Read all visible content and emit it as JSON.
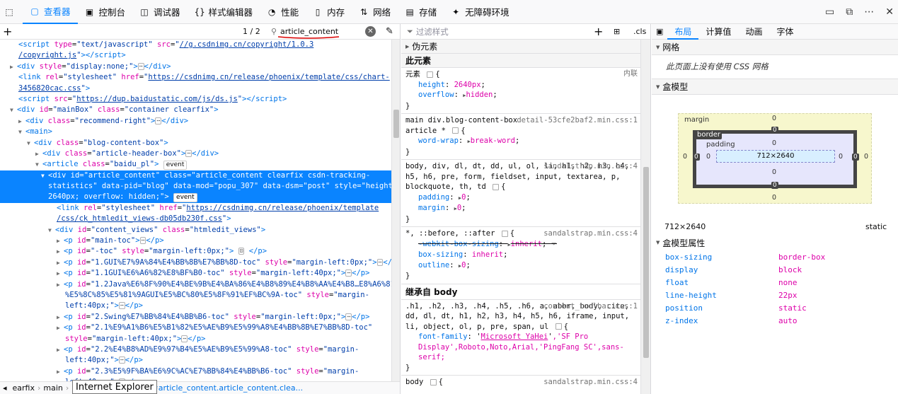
{
  "toolbar": {
    "tabs": [
      {
        "icon": "inspector-icon",
        "glyph": "▢",
        "label": "查看器"
      },
      {
        "icon": "console-icon",
        "glyph": "▣",
        "label": "控制台"
      },
      {
        "icon": "debugger-icon",
        "glyph": "◫",
        "label": "调试器"
      },
      {
        "icon": "style-editor-icon",
        "glyph": "{}",
        "label": "样式编辑器"
      },
      {
        "icon": "performance-icon",
        "glyph": "◔",
        "label": "性能"
      },
      {
        "icon": "memory-icon",
        "glyph": "▯",
        "label": "内存"
      },
      {
        "icon": "network-icon",
        "glyph": "⇅",
        "label": "网络"
      },
      {
        "icon": "storage-icon",
        "glyph": "▤",
        "label": "存储"
      },
      {
        "icon": "accessibility-icon",
        "glyph": "✦",
        "label": "无障碍环境"
      }
    ],
    "active_tab": "查看器"
  },
  "markup": {
    "search_count": "1 / 2",
    "search_value": "article_content",
    "breadcrumbs": [
      "earfix",
      "main",
      "article.baidu_pl",
      "div#article_content.article_content.clea..."
    ],
    "tooltip": "Internet Explorer"
  },
  "rules": {
    "filter_placeholder": "过滤样式",
    "cls_label": ".cls",
    "pseudo_label": "伪元素",
    "this_element_label": "此元素",
    "inherited_label": "继承自 body",
    "element_rule": {
      "selector": "元素",
      "source": "内联",
      "decls": [
        [
          "height",
          "2640px"
        ],
        [
          "overflow",
          "hidden"
        ]
      ]
    },
    "rule2": {
      "selector": "main div.blog-content-box article *",
      "source": "detail-53cfe2baf2.min.css:1",
      "decls": [
        [
          "word-wrap",
          "break-word"
        ]
      ]
    },
    "rule3": {
      "selector": "body, div, dl, dt, dd, ul, ol, li, h1, h2, h3, h4, h5, h6, pre, form, fieldset, input, textarea, p, blockquote, th, td",
      "source": "sandalstrap.min.css:4",
      "decls": [
        [
          "padding",
          "0"
        ],
        [
          "margin",
          "0"
        ]
      ]
    },
    "rule4": {
      "selector": "*, ::before, ::after",
      "source": "sandalstrap.min.css:4",
      "decls": [
        [
          "-webkit-box-sizing",
          "inherit"
        ],
        [
          "box-sizing",
          "inherit"
        ],
        [
          "outline",
          "0"
        ]
      ]
    },
    "rule5": {
      "selector": ".h1, .h2, .h3, .h4, .h5, .h6, a, abbr, body, cite, dd, dl, dt, h1, h2, h3, h4, h5, h6, iframe, input, li, object, ol, p, pre, span, ul",
      "source": "content_toolbar.css:1",
      "decl_name": "font-family",
      "decl_link": "Microsoft YaHei",
      "decl_rest": ",'SF Pro Display',Roboto,Noto,Arial,'PingFang SC',sans-serif;"
    },
    "rule6": {
      "selector": "body",
      "source": "sandalstrap.min.css:4"
    }
  },
  "layout": {
    "tabs": [
      "布局",
      "计算值",
      "动画",
      "字体"
    ],
    "active_tab": "布局",
    "grid_label": "网格",
    "grid_note": "此页面上没有使用 CSS 网格",
    "boxmodel_label": "盒模型",
    "margin_label": "margin",
    "border_label": "border",
    "padding_label": "padding",
    "content_size": "712×2640",
    "zero": "0",
    "dimensions": "712×2640",
    "position_value": "static",
    "props_label": "盒模型属性",
    "props": [
      {
        "name": "box-sizing",
        "value": "border-box"
      },
      {
        "name": "display",
        "value": "block"
      },
      {
        "name": "float",
        "value": "none"
      },
      {
        "name": "line-height",
        "value": "22px"
      },
      {
        "name": "position",
        "value": "static"
      },
      {
        "name": "z-index",
        "value": "auto"
      }
    ]
  }
}
